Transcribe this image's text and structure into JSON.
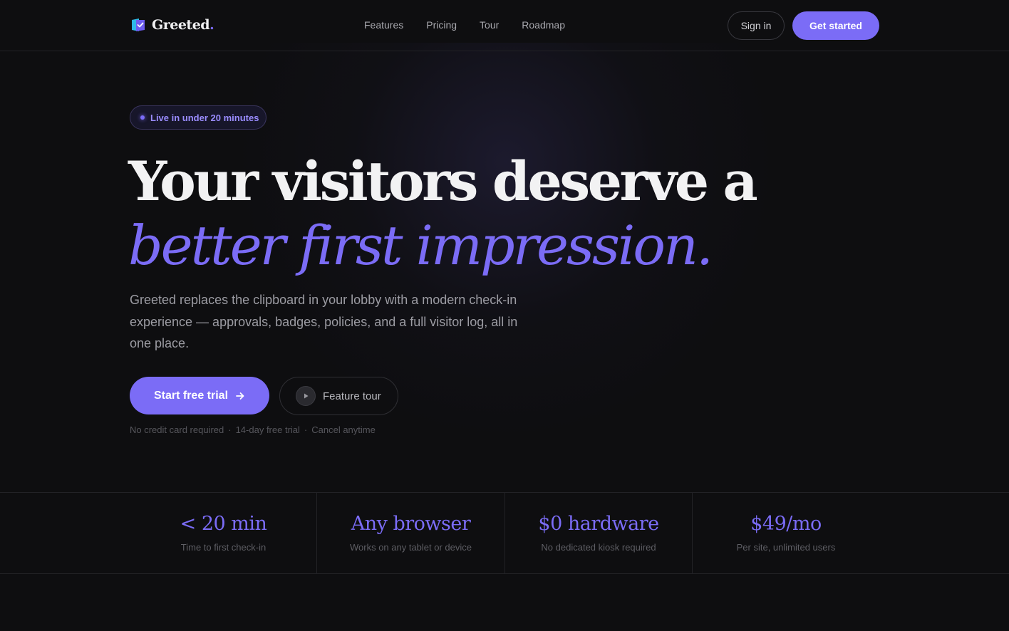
{
  "brand": {
    "name": "Greeted",
    "dot": "."
  },
  "nav": {
    "items": [
      "Features",
      "Pricing",
      "Tour",
      "Roadmap"
    ]
  },
  "header": {
    "signin_label": "Sign in",
    "cta_label": "Get started"
  },
  "hero": {
    "badge": "Live in under 20 minutes",
    "title_line1": "Your visitors deserve a",
    "title_line2": "better first impression.",
    "description": "Greeted replaces the clipboard in your lobby with a modern check-in experience — approvals, badges, policies, and a full visitor log, all in one place.",
    "primary_cta": "Start free trial",
    "primary_cta_icon": "arrow-right-icon",
    "secondary_cta": "Feature tour",
    "secondary_cta_icon": "play-icon",
    "fineprint": [
      "No credit card required",
      "14-day free trial",
      "Cancel anytime"
    ],
    "fineprint_separator": "·"
  },
  "stats": [
    {
      "value": "< 20 min",
      "label": "Time to first check-in"
    },
    {
      "value": "Any browser",
      "label": "Works on any tablet or device"
    },
    {
      "value": "$0 hardware",
      "label": "No dedicated kiosk required"
    },
    {
      "value": "$49/mo",
      "label": "Per site, unlimited users"
    }
  ],
  "colors": {
    "accent": "#7b6cf6",
    "background": "#0e0e10"
  }
}
